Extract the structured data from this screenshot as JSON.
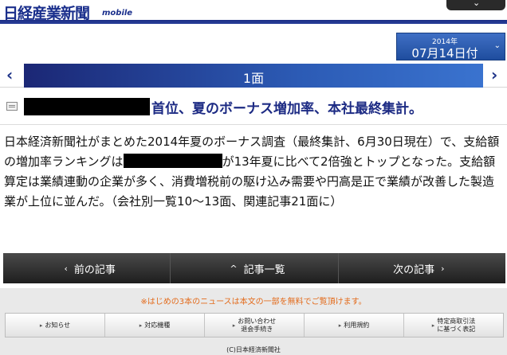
{
  "header": {
    "logo": "日経産業新聞",
    "logo_sub": "mobile",
    "menu_icon": "chevron-down-icon"
  },
  "date": {
    "year": "2014年",
    "day": "07月14日付",
    "icon": "chevron-down-icon"
  },
  "page_nav": {
    "label": "1面",
    "prev_icon": "chevron-left-icon",
    "next_icon": "chevron-right-icon"
  },
  "article": {
    "icon": "article-icon",
    "headline": "首位、夏のボーナス増加率、本社最終集計。",
    "body_part1": "日本経済新聞社がまとめた2014年夏のボーナス調査（最終集計、6月30日現在）で、支給額の増加率ランキングは",
    "body_part2": "が13年夏に比べて2倍強とトップとなった。支給額算定は業績連動の企業が多く、消費増税前の駆け込み需要や円高是正で業績が改善した製造業が上位に並んだ。（会社別一覧10～13面、関連記事21面に）"
  },
  "nav": {
    "prev": "前の記事",
    "list": "記事一覧",
    "next": "次の記事"
  },
  "footer": {
    "notice": "※はじめの3本のニュースは本文の一部を無料でご覧頂けます。",
    "links": [
      {
        "label": "お知らせ"
      },
      {
        "label": "対応機種"
      },
      {
        "label": "お問い合わせ",
        "label2": "退会手続き"
      },
      {
        "label": "利用規約"
      },
      {
        "label": "特定商取引法",
        "label2": "に基づく表記"
      }
    ],
    "copyright": "(C)日本経済新聞社"
  }
}
